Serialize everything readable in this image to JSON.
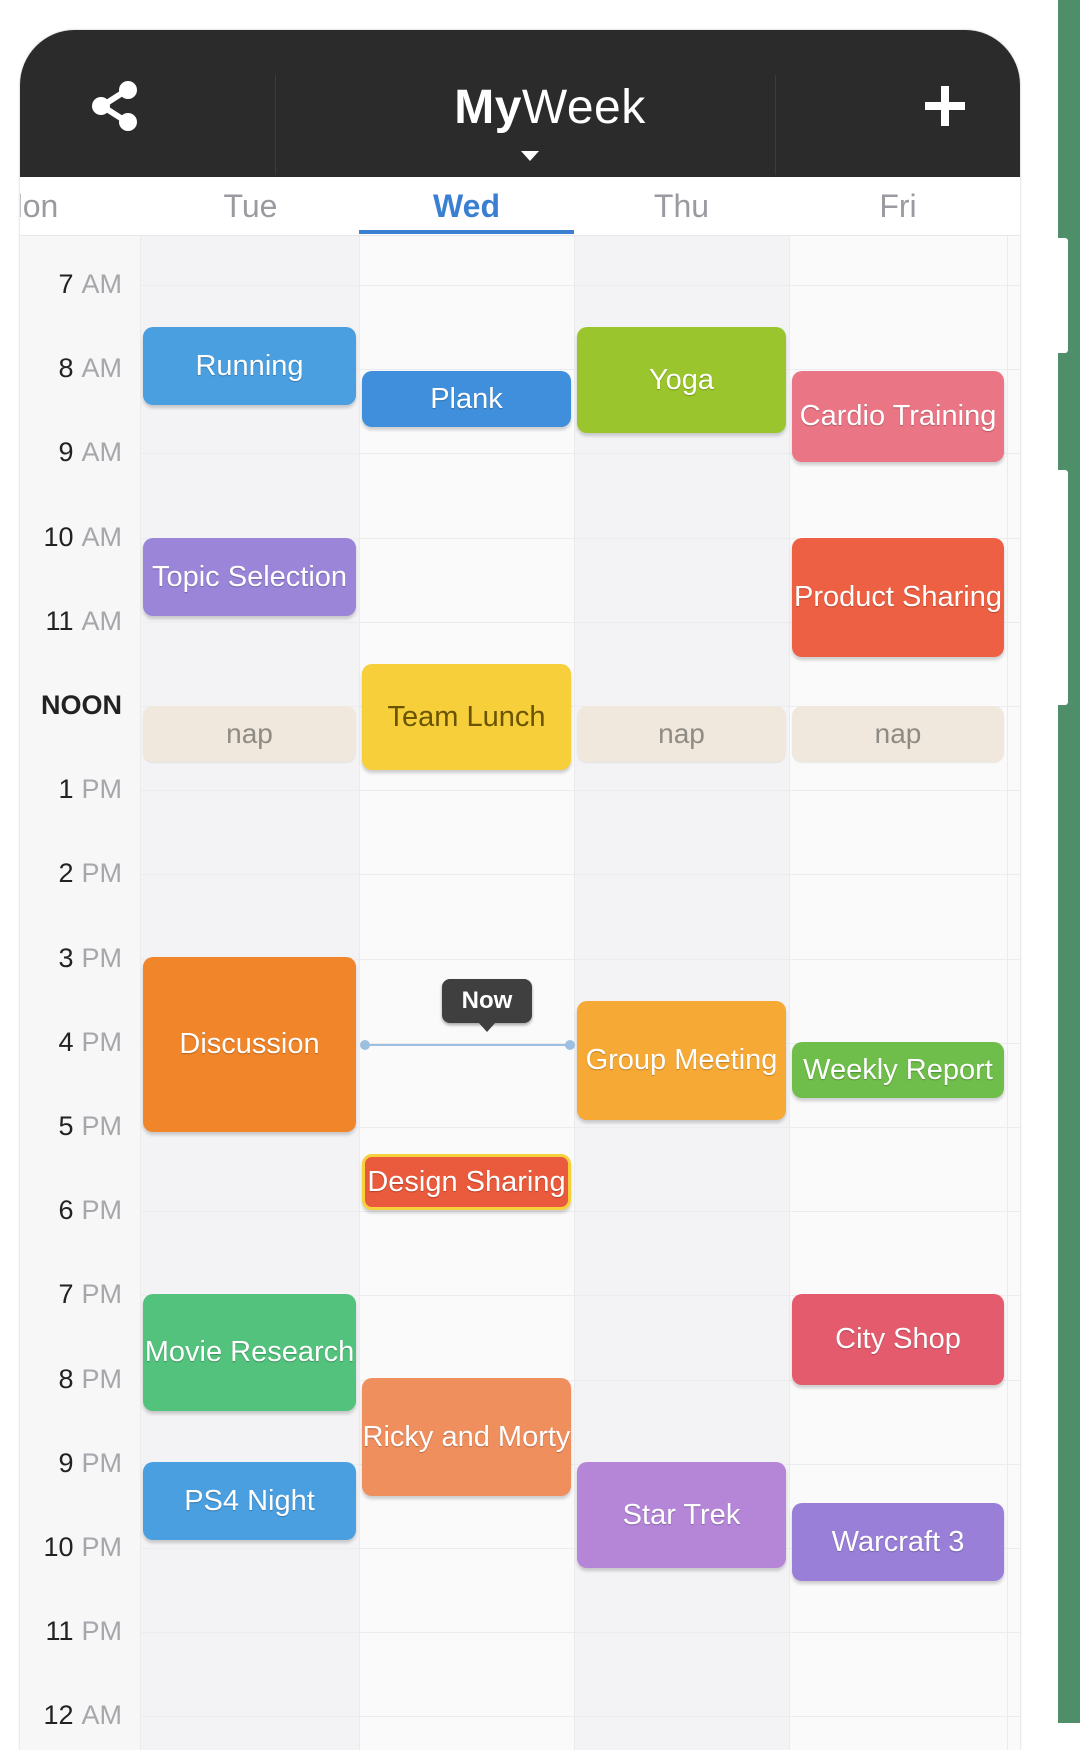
{
  "header": {
    "title_bold": "My",
    "title_light": "Week",
    "share_icon": "share-icon",
    "add_icon": "plus-icon"
  },
  "days": [
    {
      "label": "Mon",
      "visible_text": "lon",
      "active": false
    },
    {
      "label": "Tue",
      "active": false
    },
    {
      "label": "Wed",
      "active": true
    },
    {
      "label": "Thu",
      "active": false
    },
    {
      "label": "Fri",
      "active": false
    }
  ],
  "times": [
    {
      "h": "7",
      "u": "AM"
    },
    {
      "h": "8",
      "u": "AM"
    },
    {
      "h": "9",
      "u": "AM"
    },
    {
      "h": "10",
      "u": "AM"
    },
    {
      "h": "11",
      "u": "AM"
    },
    {
      "h": "NOON",
      "u": ""
    },
    {
      "h": "1",
      "u": "PM"
    },
    {
      "h": "2",
      "u": "PM"
    },
    {
      "h": "3",
      "u": "PM"
    },
    {
      "h": "4",
      "u": "PM"
    },
    {
      "h": "5",
      "u": "PM"
    },
    {
      "h": "6",
      "u": "PM"
    },
    {
      "h": "7",
      "u": "PM"
    },
    {
      "h": "8",
      "u": "PM"
    },
    {
      "h": "9",
      "u": "PM"
    },
    {
      "h": "10",
      "u": "PM"
    },
    {
      "h": "11",
      "u": "PM"
    },
    {
      "h": "12",
      "u": "AM"
    }
  ],
  "now_label": "Now",
  "colors": {
    "header": "#2b2b2b",
    "active_day": "#3b7fd3",
    "blue": "#4a9fe0",
    "purple": "#9a85d8",
    "yellow": "#f6cf3a",
    "green_lime": "#9bc52c",
    "pink": "#ea7585",
    "red_orange": "#ee6043",
    "orange": "#f0852a",
    "amber": "#f7a935",
    "green": "#6fbd4a",
    "mint": "#52c27c",
    "salmon": "#f08f5e",
    "violet": "#b586d8",
    "nap": "#f0e8dc"
  },
  "events": {
    "tue": [
      {
        "title": "Running",
        "color": "#4a9fe0"
      },
      {
        "title": "Topic Selection",
        "color": "#9a85d8"
      },
      {
        "title": "nap",
        "color": "#f0e8dc"
      },
      {
        "title": "Discussion",
        "color": "#f0852a"
      },
      {
        "title": "Movie Research",
        "color": "#52c27c"
      },
      {
        "title": "PS4 Night",
        "color": "#4a9fe0"
      }
    ],
    "wed": [
      {
        "title": "Plank",
        "color": "#3f8fdc"
      },
      {
        "title": "Team Lunch",
        "color": "#f6cf3a"
      },
      {
        "title": "Design Sharing",
        "color": "#ea5a3c"
      },
      {
        "title": "Ricky and Morty",
        "color": "#f08f5e"
      }
    ],
    "thu": [
      {
        "title": "Yoga",
        "color": "#9bc52c"
      },
      {
        "title": "nap",
        "color": "#f0e8dc"
      },
      {
        "title": "Group Meeting",
        "color": "#f7a935"
      },
      {
        "title": "Star Trek",
        "color": "#b586d8"
      }
    ],
    "fri": [
      {
        "title": "Cardio Training",
        "color": "#ea7585"
      },
      {
        "title": "Product Sharing",
        "color": "#ee6043"
      },
      {
        "title": "nap",
        "color": "#f0e8dc"
      },
      {
        "title": "Weekly Report",
        "color": "#6fbd4a"
      },
      {
        "title": "City Shop",
        "color": "#e45b6e"
      },
      {
        "title": "Warcraft 3",
        "color": "#9a7fd8"
      }
    ]
  }
}
